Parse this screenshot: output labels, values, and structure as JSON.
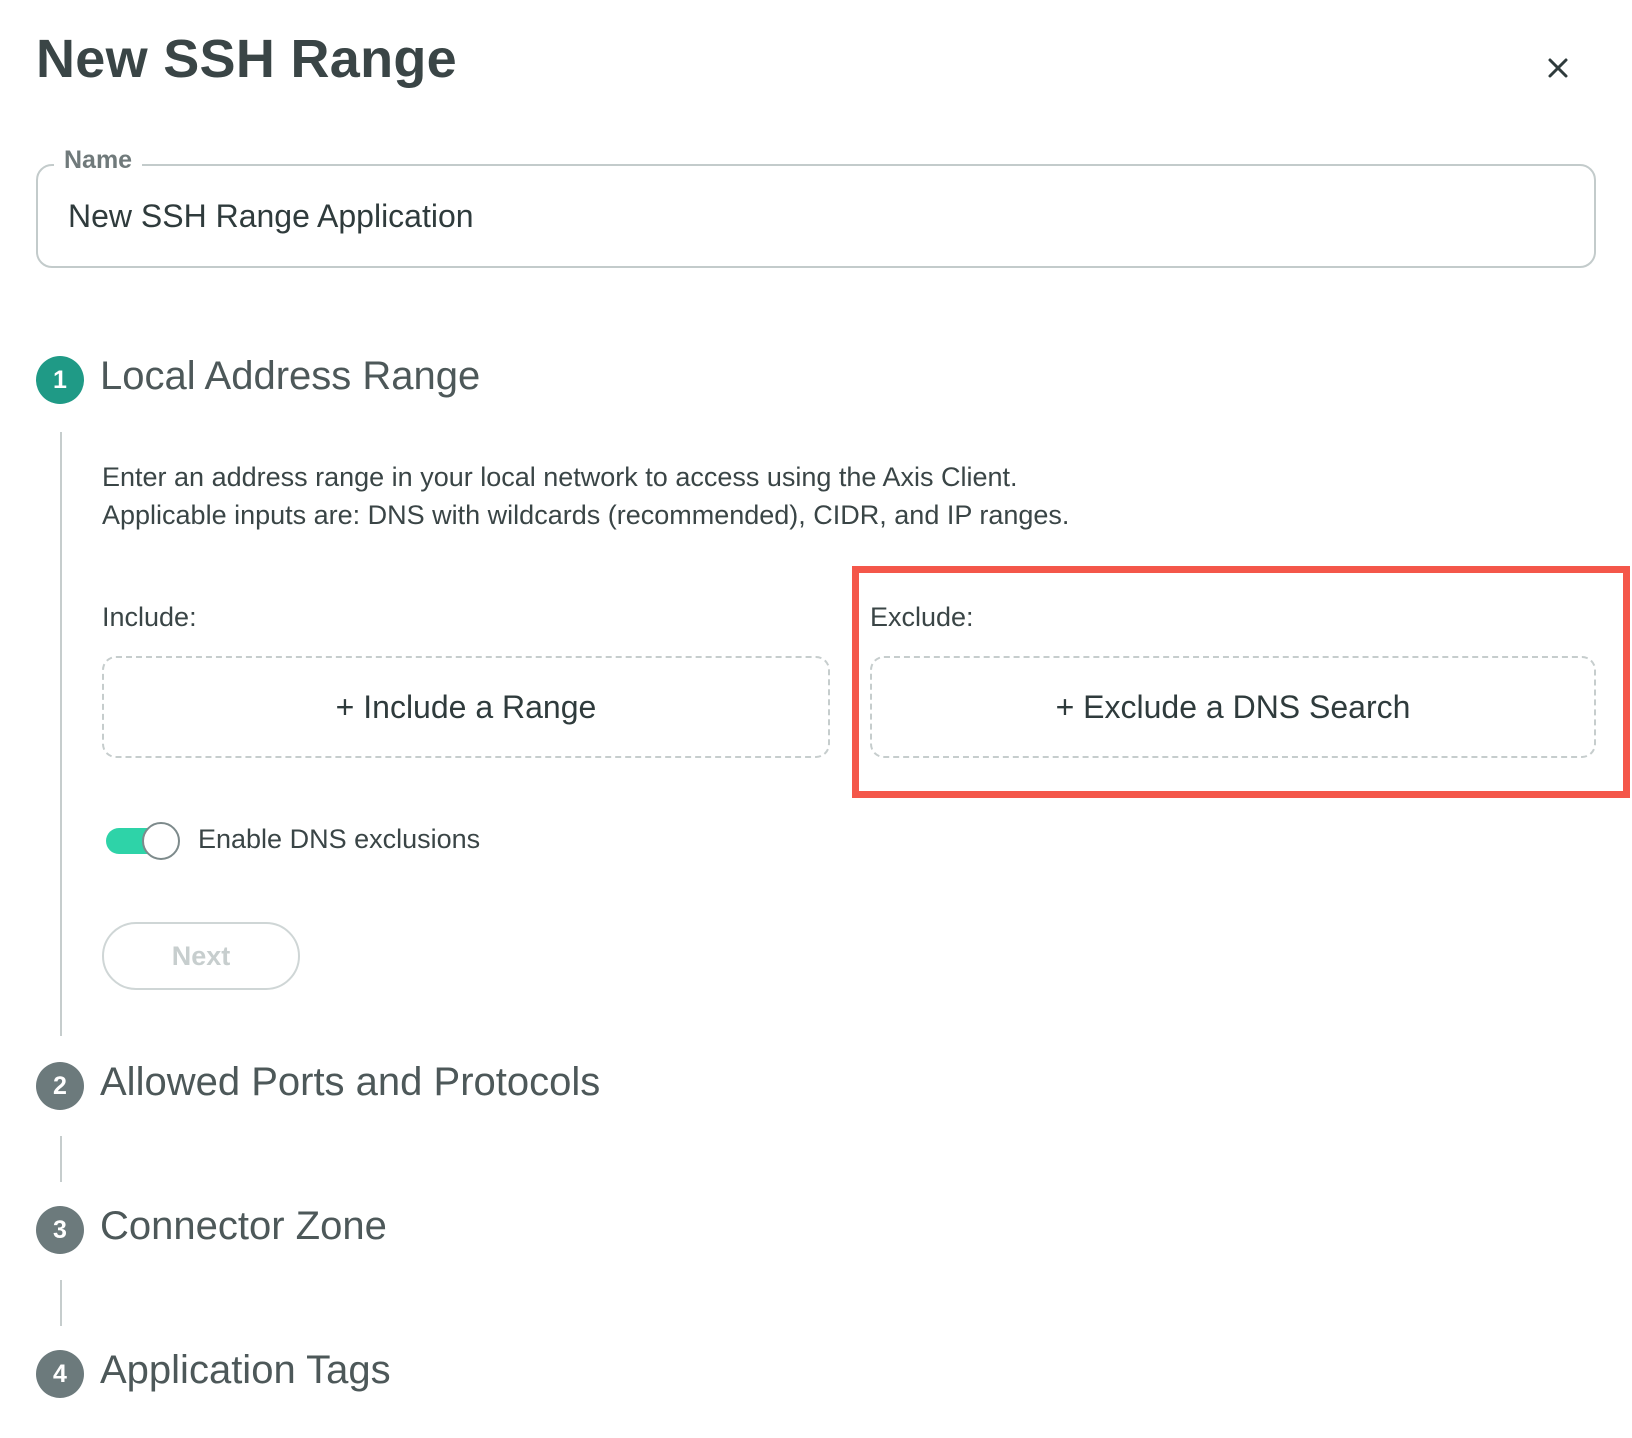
{
  "dialog": {
    "title": "New SSH Range",
    "close_icon": "close-icon"
  },
  "name_field": {
    "label": "Name",
    "value": "New SSH Range Application"
  },
  "steps": [
    {
      "number": "1",
      "title": "Local Address Range",
      "status": "active",
      "description_line1": "Enter an address range in your local network to access using the Axis Client.",
      "description_line2": "Applicable inputs are: DNS with wildcards (recommended), CIDR, and IP ranges.",
      "include": {
        "label": "Include:",
        "button_label": "+ Include a Range"
      },
      "exclude": {
        "label": "Exclude:",
        "button_label": "+ Exclude a DNS Search"
      },
      "dns_exclusions_toggle": {
        "label": "Enable DNS exclusions",
        "enabled": true
      },
      "next_button": {
        "label": "Next",
        "disabled": true
      }
    },
    {
      "number": "2",
      "title": "Allowed Ports and Protocols",
      "status": "inactive"
    },
    {
      "number": "3",
      "title": "Connector Zone",
      "status": "inactive"
    },
    {
      "number": "4",
      "title": "Application Tags",
      "status": "inactive"
    }
  ],
  "colors": {
    "active_step": "#1f9a86",
    "inactive_step": "#6c7a7c",
    "toggle_on": "#2ed3a8",
    "highlight": "#f4574a"
  }
}
